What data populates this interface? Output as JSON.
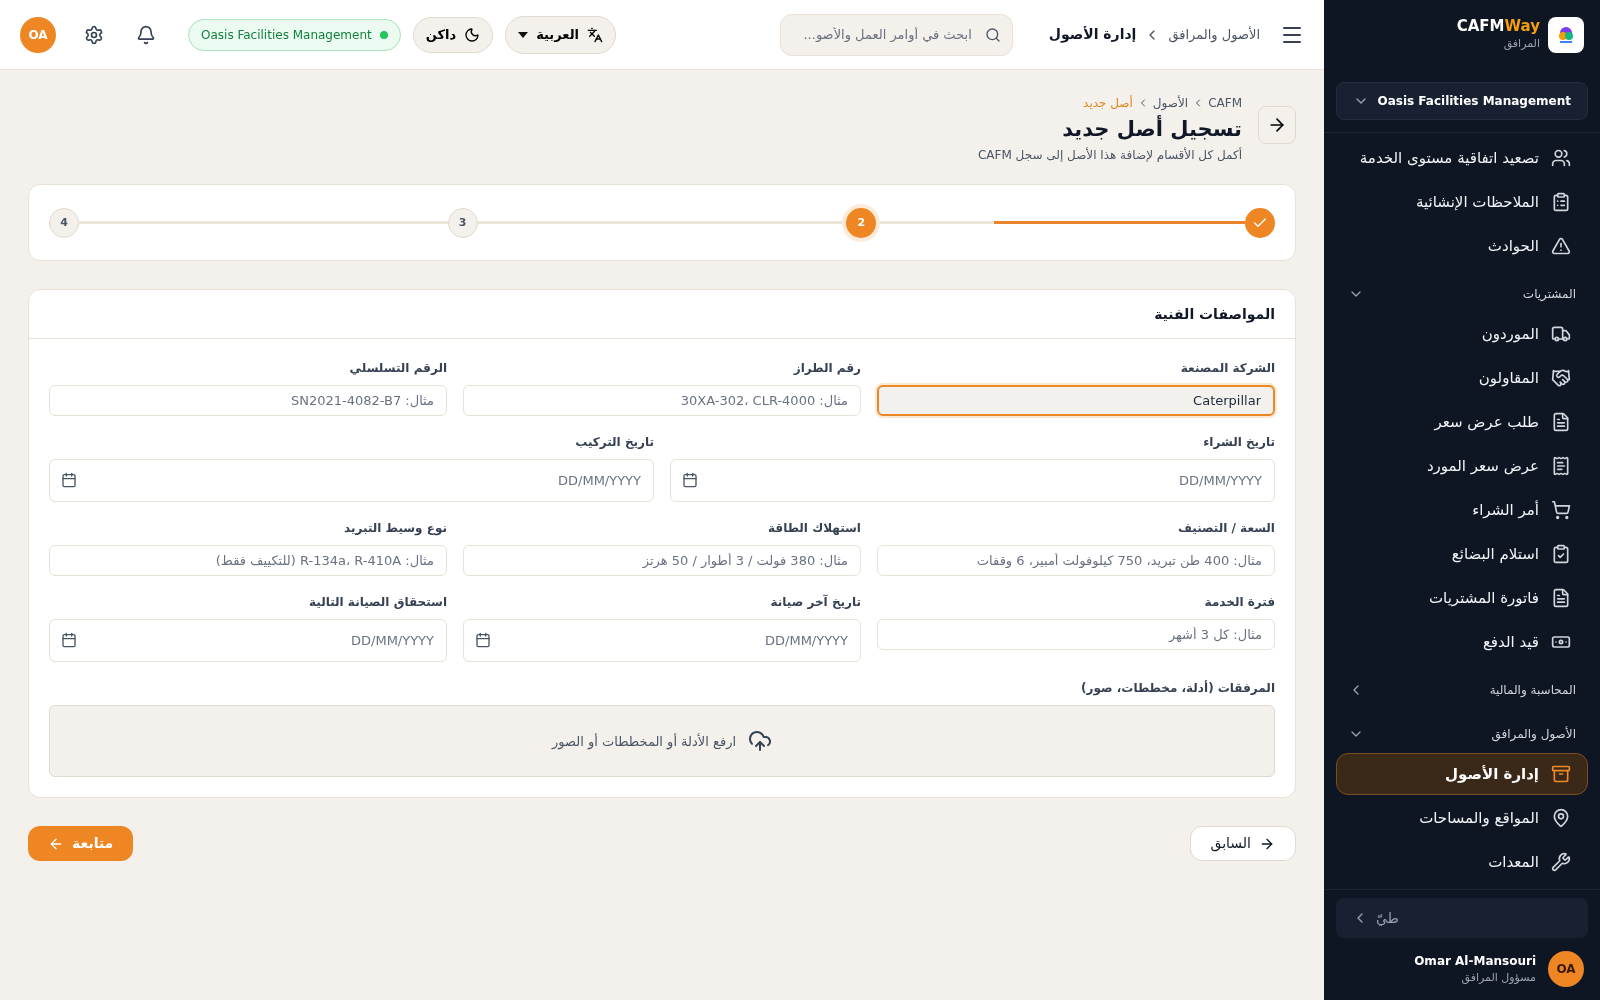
{
  "sidebar": {
    "logo": {
      "brand": "CAFM",
      "brand_accent": "Way",
      "subtitle": "المرافق"
    },
    "org_select": {
      "value": "Oasis Facilities Management"
    },
    "items": [
      {
        "kind": "item",
        "label": "تصعيد اتفاقية مستوى الخدمة",
        "selected": false
      },
      {
        "kind": "item",
        "label": "الملاحظات الإنشائية",
        "selected": false
      },
      {
        "kind": "item",
        "label": "الحوادث",
        "selected": false
      },
      {
        "kind": "section",
        "label": "المشتريات",
        "expanded": true
      },
      {
        "kind": "item",
        "label": "الموردون",
        "selected": false
      },
      {
        "kind": "item",
        "label": "المقاولون",
        "selected": false
      },
      {
        "kind": "item",
        "label": "طلب عرض سعر",
        "selected": false
      },
      {
        "kind": "item",
        "label": "عرض سعر المورد",
        "selected": false
      },
      {
        "kind": "item",
        "label": "أمر الشراء",
        "selected": false
      },
      {
        "kind": "item",
        "label": "استلام البضائع",
        "selected": false
      },
      {
        "kind": "item",
        "label": "فاتورة المشتريات",
        "selected": false
      },
      {
        "kind": "item",
        "label": "قيد الدفع",
        "selected": false
      },
      {
        "kind": "section",
        "label": "المحاسبة والمالية",
        "expanded": false
      },
      {
        "kind": "section",
        "label": "الأصول والمرافق",
        "expanded": true
      },
      {
        "kind": "item",
        "label": "إدارة الأصول",
        "selected": true
      },
      {
        "kind": "item",
        "label": "المواقع والمساحات",
        "selected": false
      },
      {
        "kind": "item",
        "label": "المعدات",
        "selected": false
      }
    ],
    "collapse": {
      "label": "طيّ"
    },
    "user": {
      "initials": "OA",
      "name": "Omar Al-Mansouri",
      "role": "مسؤول المرافق"
    }
  },
  "topbar": {
    "breadcrumb": [
      "الأصول والمرافق",
      "إدارة الأصول"
    ],
    "search": {
      "placeholder": "ابحث في أوامر العمل والأصو..."
    },
    "language": "العربية",
    "theme": "داكن",
    "org_badge": "Oasis Facilities Management",
    "avatar": "OA"
  },
  "page": {
    "breadcrumb": [
      "CAFM",
      "الأصول",
      "أصل جديد"
    ],
    "title": "تسجيل أصل جديد",
    "subtitle": "أكمل كل الأقسام لإضافة هذا الأصل إلى سجل CAFM"
  },
  "stepper": {
    "steps": [
      {
        "completed": true,
        "selected": false
      },
      {
        "label": "2",
        "completed": false,
        "selected": true
      },
      {
        "label": "3",
        "completed": false,
        "selected": false
      },
      {
        "label": "4",
        "completed": false,
        "selected": false
      }
    ],
    "connectors": [
      {
        "level": 0.68
      },
      {
        "level": 0
      },
      {
        "level": 0
      }
    ]
  },
  "section": {
    "title": "المواصفات الفنية",
    "rows": [
      [
        {
          "kind": "text",
          "label": "الشركة المصنعة",
          "value": "Caterpillar",
          "focused": true
        },
        {
          "kind": "text",
          "label": "رقم الطراز",
          "placeholder": "مثال: 30XA-302، CLR-4000",
          "focused": false
        },
        {
          "kind": "text",
          "label": "الرقم التسلسلي",
          "placeholder": "مثال: SN2021-4082-B7",
          "focused": false
        }
      ],
      [
        {
          "kind": "date",
          "label": "تاريخ الشراء",
          "placeholder": "DD/MM/YYYY",
          "focused": false
        },
        {
          "kind": "date",
          "label": "تاريخ التركيب",
          "placeholder": "DD/MM/YYYY",
          "focused": false
        }
      ],
      [
        {
          "kind": "text",
          "label": "السعة / التصنيف",
          "placeholder": "مثال: 400 طن تبريد، 750 كيلوفولت أمبير، 6 وقفات",
          "focused": false
        },
        {
          "kind": "text",
          "label": "استهلاك الطاقة",
          "placeholder": "مثال: 380 فولت / 3 أطوار / 50 هرتز",
          "focused": false
        },
        {
          "kind": "text",
          "label": "نوع وسيط التبريد",
          "placeholder": "مثال: R-134a، R-410A (للتكييف فقط)",
          "focused": false
        }
      ],
      [
        {
          "kind": "text",
          "label": "فترة الخدمة",
          "placeholder": "مثال: كل 3 أشهر",
          "focused": false
        },
        {
          "kind": "date",
          "label": "تاريخ آخر صيانة",
          "placeholder": "DD/MM/YYYY",
          "focused": false
        },
        {
          "kind": "date",
          "label": "استحقاق الصيانة التالية",
          "placeholder": "DD/MM/YYYY",
          "focused": false
        }
      ]
    ],
    "attachments": {
      "label": "المرفقات (أدلة، مخططات، صور)",
      "hint": "ارفع الأدلة أو المخططات أو الصور"
    }
  },
  "actions": {
    "previous": "السابق",
    "next": "متابعة"
  }
}
